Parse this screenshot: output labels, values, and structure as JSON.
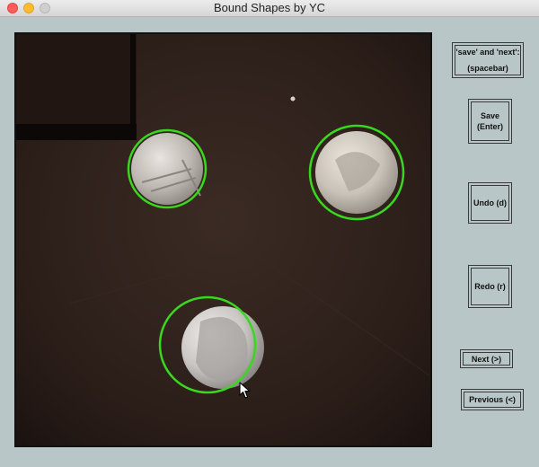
{
  "window": {
    "title": "Bound Shapes by YC"
  },
  "buttons": {
    "save_next": {
      "line1": "'save' and 'next':",
      "line2": "(spacebar)"
    },
    "save": {
      "line1": "Save",
      "line2": "(Enter)"
    },
    "undo": {
      "label": "Undo (d)"
    },
    "redo": {
      "label": "Redo (r)"
    },
    "next": {
      "label": "Next (>)"
    },
    "previous": {
      "label": "Previous (<)"
    }
  },
  "colors": {
    "accent": "#39d81e",
    "background": "#b9c6c7"
  },
  "icons": {
    "cursor": "mouse-pointer-icon"
  }
}
